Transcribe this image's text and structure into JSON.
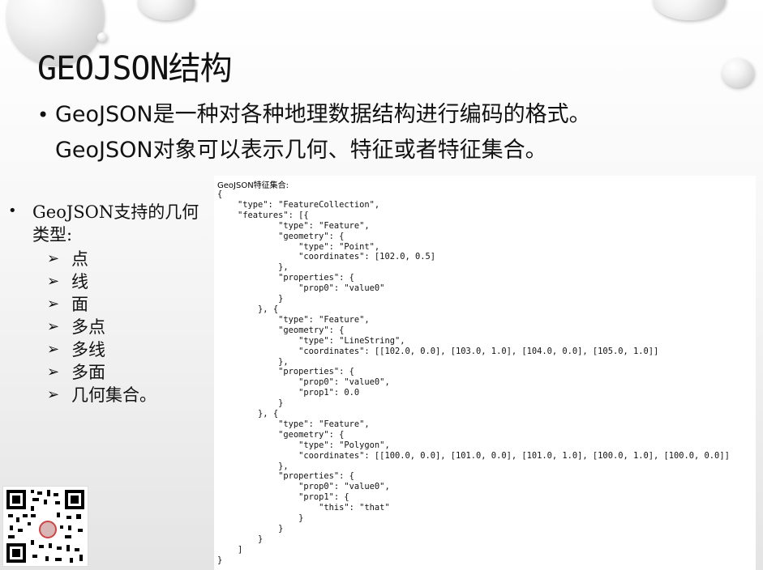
{
  "slide": {
    "title": "GEOJSON结构",
    "intro": {
      "line1": "GeoJSON是一种对各种地理数据结构进行编码的格式。",
      "line2": "GeoJSON对象可以表示几何、特征或者特征集合。"
    },
    "types": {
      "heading": "GeoJSON支持的几何类型:",
      "items": [
        "点",
        "线",
        "面",
        "多点",
        "多线",
        "多面",
        "几何集合。"
      ]
    },
    "code_panel": {
      "label": "GeoJSON特征集合:",
      "code": "{\n    \"type\": \"FeatureCollection\",\n    \"features\": [{\n            \"type\": \"Feature\",\n            \"geometry\": {\n                \"type\": \"Point\",\n                \"coordinates\": [102.0, 0.5]\n            },\n            \"properties\": {\n                \"prop0\": \"value0\"\n            }\n        }, {\n            \"type\": \"Feature\",\n            \"geometry\": {\n                \"type\": \"LineString\",\n                \"coordinates\": [[102.0, 0.0], [103.0, 1.0], [104.0, 0.0], [105.0, 1.0]]\n            },\n            \"properties\": {\n                \"prop0\": \"value0\",\n                \"prop1\": 0.0\n            }\n        }, {\n            \"type\": \"Feature\",\n            \"geometry\": {\n                \"type\": \"Polygon\",\n                \"coordinates\": [[100.0, 0.0], [101.0, 0.0], [101.0, 1.0], [100.0, 1.0], [100.0, 0.0]]\n            },\n            \"properties\": {\n                \"prop0\": \"value0\",\n                \"prop1\": {\n                    \"this\": \"that\"\n                }\n            }\n        }\n    ]\n}"
    }
  }
}
